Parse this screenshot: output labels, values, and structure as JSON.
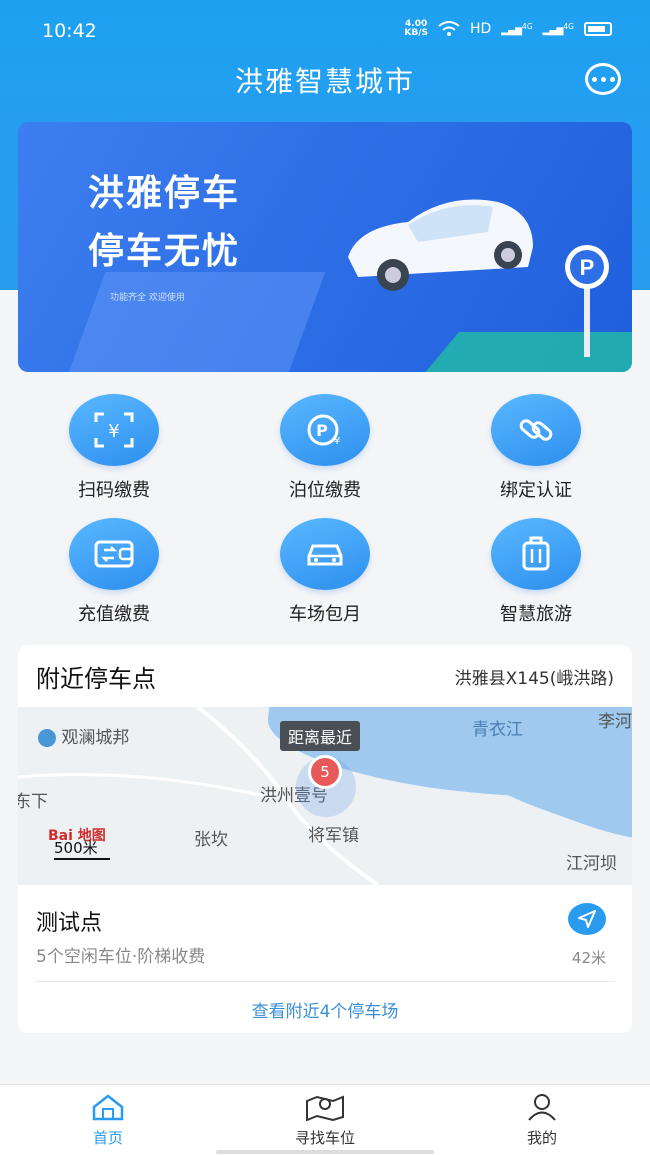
{
  "status_bar": {
    "time": "10:42",
    "speed": "4.00",
    "speed_unit": "KB/S",
    "network": "HD",
    "signal1": "4G",
    "signal2": "4G"
  },
  "header": {
    "title": "洪雅智慧城市",
    "chat_icon": "chat-bubble-icon"
  },
  "banner": {
    "line1": "洪雅停车",
    "line2": "停车无忧",
    "subtitle": "功能齐全 欢迎使用",
    "sign_letter": "P"
  },
  "services": [
    {
      "label": "扫码缴费",
      "icon": "scan-yuan-icon"
    },
    {
      "label": "泊位缴费",
      "icon": "parking-yuan-icon"
    },
    {
      "label": "绑定认证",
      "icon": "link-icon"
    },
    {
      "label": "充值缴费",
      "icon": "wallet-icon"
    },
    {
      "label": "车场包月",
      "icon": "car-icon"
    },
    {
      "label": "智慧旅游",
      "icon": "luggage-icon"
    }
  ],
  "nearby": {
    "title": "附近停车点",
    "location": "洪雅县X145(峨洪路)",
    "map": {
      "callout": "距离最近",
      "pin_count": "5",
      "labels": {
        "guanlan": "观澜城邦",
        "qingyijiang": "青衣江",
        "li": "李河",
        "xia": "东下",
        "hongzhou": "洪州壹号",
        "zhangkan": "张坎",
        "jiangjun": "将军镇",
        "jianghe": "江河坝"
      },
      "logo": "Bai 地图",
      "scale": "500米"
    },
    "lot": {
      "name": "测试点",
      "info": "5个空闲车位·阶梯收费",
      "distance": "42米"
    },
    "view_more": "查看附近4个停车场"
  },
  "tabbar": {
    "tabs": [
      {
        "label": "首页",
        "active": true
      },
      {
        "label": "寻找车位",
        "active": false
      },
      {
        "label": "我的",
        "active": false
      }
    ],
    "active_color": "#2a9cf0",
    "inactive_color": "#333333"
  }
}
